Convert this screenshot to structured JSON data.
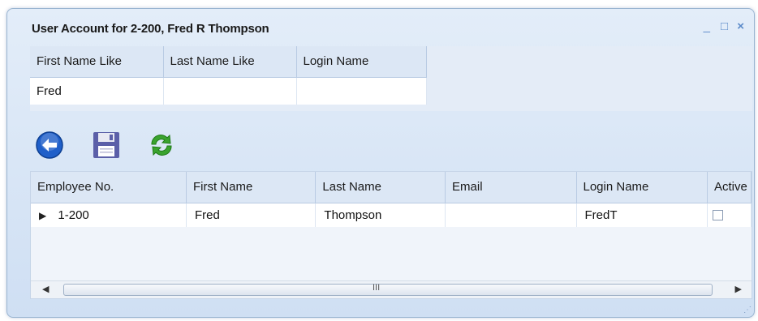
{
  "window": {
    "title": "User Account for 2-200, Fred R Thompson",
    "min_glyph": "_",
    "max_glyph": "□",
    "close_glyph": "×"
  },
  "filter": {
    "columns": [
      "First Name Like",
      "Last Name Like",
      "Login Name"
    ],
    "values": [
      "Fred",
      "",
      ""
    ]
  },
  "toolbar": {
    "buttons": [
      {
        "name": "back",
        "icon": "back-arrow-icon"
      },
      {
        "name": "save",
        "icon": "floppy-disk-icon"
      },
      {
        "name": "refresh",
        "icon": "refresh-icon"
      }
    ]
  },
  "grid": {
    "columns": [
      "Employee No.",
      "First Name",
      "Last Name",
      "Email",
      "Login Name",
      "Active"
    ],
    "rows": [
      {
        "employee_no": "1-200",
        "first_name": "Fred",
        "last_name": "Thompson",
        "email": "",
        "login_name": "FredT",
        "active": false
      }
    ],
    "row_indicator": "▶",
    "scroll_grip": "III"
  },
  "colors": {
    "accent": "#1f5fc9",
    "save": "#5b5fa8",
    "refresh": "#3aa32e"
  }
}
